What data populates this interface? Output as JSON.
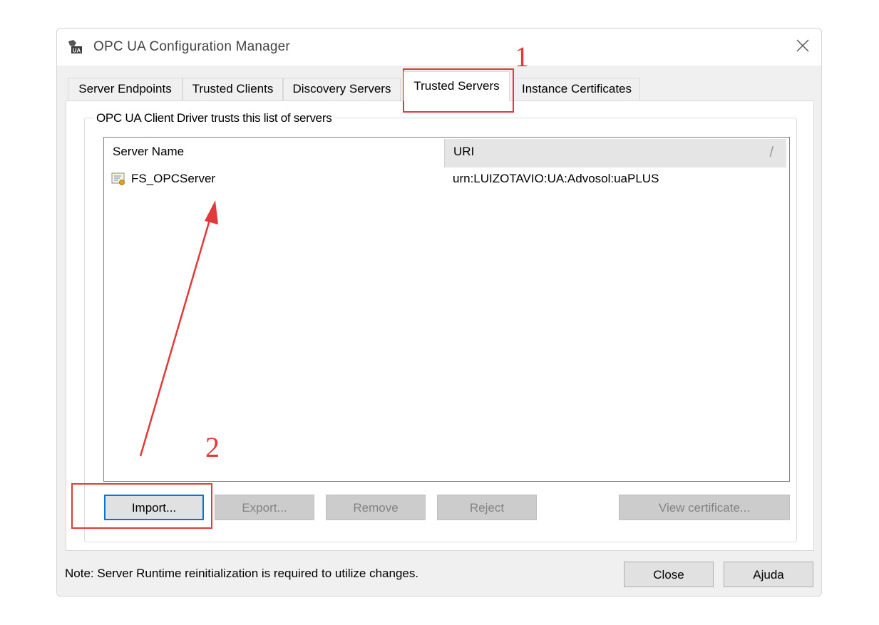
{
  "window": {
    "title": "OPC UA Configuration Manager",
    "close_glyph": "✕"
  },
  "tabs": [
    {
      "label": "Server Endpoints"
    },
    {
      "label": "Trusted Clients"
    },
    {
      "label": "Discovery Servers"
    },
    {
      "label": "Trusted Servers",
      "active": true
    },
    {
      "label": "Instance Certificates"
    }
  ],
  "group": {
    "legend": "OPC UA Client Driver trusts this list of servers"
  },
  "list": {
    "columns": [
      "Server Name",
      "URI"
    ],
    "sort_glyph": "/",
    "rows": [
      {
        "name": "FS_OPCServer",
        "uri": "urn:LUIZOTAVIO:UA:Advosol:uaPLUS",
        "icon": "certificate-icon"
      }
    ]
  },
  "buttons": {
    "import": "Import...",
    "export": "Export...",
    "remove": "Remove",
    "reject": "Reject",
    "view_certificate": "View certificate...",
    "close": "Close",
    "help": "Ajuda"
  },
  "note": "Note: Server Runtime reinitialization is required to utilize changes.",
  "annotations": {
    "step1": "1",
    "step2": "2",
    "color": "#e03a3a"
  }
}
